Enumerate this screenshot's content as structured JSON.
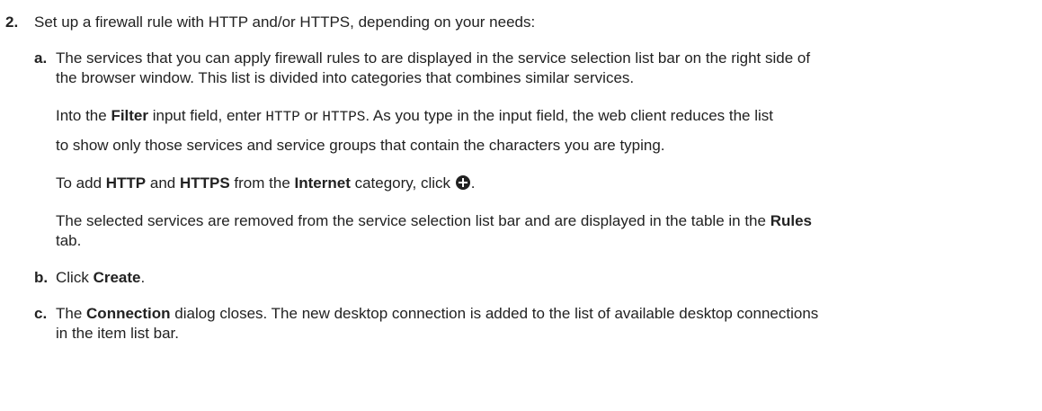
{
  "step2": {
    "number": "2.",
    "text": "Set up a firewall rule with HTTP and/or HTTPS, depending on your needs:"
  },
  "step_a": {
    "letter": "a.",
    "line1": "The services that you can apply firewall rules to are displayed in the service selection list bar on the right side of",
    "line2": "the browser window. This list is divided into categories that combines similar services.",
    "filter_pre": "Into the ",
    "filter_label": "Filter",
    "filter_mid": " input field, enter ",
    "code_http": "HTTP",
    "or": " or ",
    "code_https": "HTTPS",
    "filter_post": ". As you type in the input field, the web client reduces the list",
    "filter_line2": "to show only those services and service groups that contain the characters you are typing.",
    "add_pre": "To add ",
    "add_http": "HTTP",
    "add_and": " and ",
    "add_https": "HTTPS",
    "add_from": " from the ",
    "add_internet": "Internet",
    "add_category": " category, click ",
    "add_end": ".",
    "removed_line1": "The selected services are removed from the service selection list bar and are displayed in the table in the ",
    "removed_rules": "Rules",
    "removed_line2": "tab."
  },
  "step_b": {
    "letter": "b.",
    "pre": "Click ",
    "create": "Create",
    "post": "."
  },
  "step_c": {
    "letter": "c.",
    "pre": "The ",
    "connection": "Connection",
    "line1_post": " dialog closes. The new desktop connection is added to the list of available desktop connections",
    "line2": "in the item list bar."
  }
}
